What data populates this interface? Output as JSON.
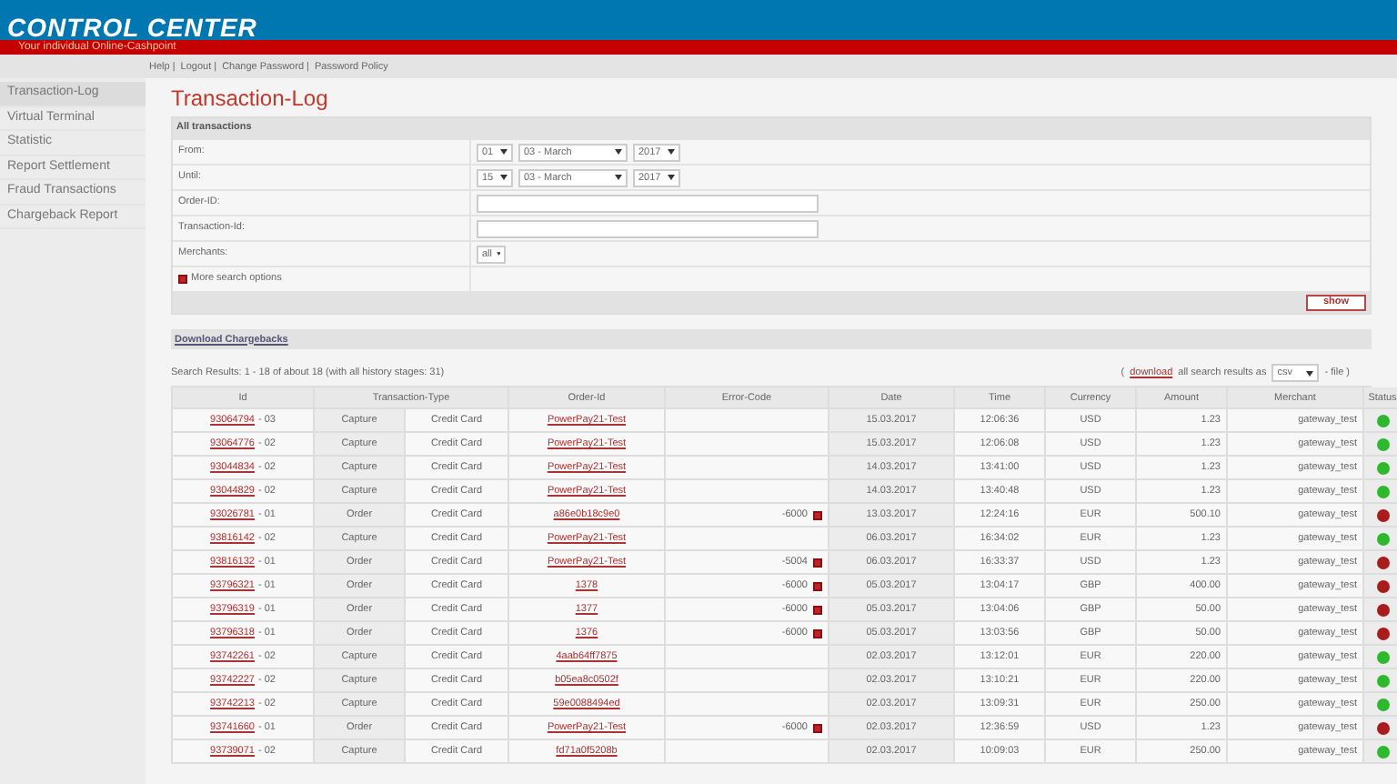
{
  "header": {
    "title": "CONTROL CENTER",
    "subtitle": "Your individual Online-Cashpoint"
  },
  "top_links": [
    "Help |",
    "Logout |",
    "Change Password |",
    "Password Policy"
  ],
  "sidebar": {
    "items": [
      {
        "label": "Transaction-Log",
        "selected": true
      },
      {
        "label": "Virtual Terminal",
        "selected": false
      },
      {
        "label": "Statistic",
        "selected": false
      },
      {
        "label": "Report Settlement",
        "selected": false
      },
      {
        "label": "Fraud Transactions",
        "selected": false
      },
      {
        "label": "Chargeback Report",
        "selected": false
      }
    ]
  },
  "page_title": "Transaction-Log",
  "search_panel": {
    "title": "All transactions",
    "fields": [
      {
        "kind": "date",
        "label": "From:",
        "day": "01",
        "month": "03 - March",
        "year": "2017"
      },
      {
        "kind": "date",
        "label": "Until:",
        "day": "15",
        "month": "03 - March",
        "year": "2017"
      },
      {
        "kind": "text",
        "label": "Order-ID:"
      },
      {
        "kind": "text",
        "label": "Transaction-Id:"
      },
      {
        "kind": "select",
        "label": "Merchants:",
        "value": "all"
      }
    ],
    "more_options": "More search options",
    "show_button": "show"
  },
  "download_chargebacks": "Download Chargebacks",
  "results": {
    "summary": "Search Results:  1 - 18 of about  18  (with all history stages: 31)",
    "export_open": "(",
    "export_link": "download",
    "export_text": "all search results as",
    "export_format": "csv",
    "export_close": "- file )"
  },
  "table": {
    "columns": [
      "Id",
      "Transaction-Type",
      "Order-Id",
      "Error-Code",
      "Date",
      "Time",
      "Currency",
      "Amount",
      "Merchant",
      "Status"
    ],
    "rows": [
      {
        "id": "93064794",
        "stage": "- 03",
        "type": "Capture",
        "method": "Credit Card",
        "order": "PowerPay21-Test",
        "error": "",
        "date": "15.03.2017",
        "time": "12:06:36",
        "currency": "USD",
        "amount": "1.23",
        "merchant": "gateway_test",
        "color": "#2db82d"
      },
      {
        "id": "93064776",
        "stage": "- 02",
        "type": "Capture",
        "method": "Credit Card",
        "order": "PowerPay21-Test",
        "error": "",
        "date": "15.03.2017",
        "time": "12:06:08",
        "currency": "USD",
        "amount": "1.23",
        "merchant": "gateway_test",
        "color": "#2db82d"
      },
      {
        "id": "93044834",
        "stage": "- 02",
        "type": "Capture",
        "method": "Credit Card",
        "order": "PowerPay21-Test",
        "error": "",
        "date": "14.03.2017",
        "time": "13:41:00",
        "currency": "USD",
        "amount": "1.23",
        "merchant": "gateway_test",
        "color": "#2db82d"
      },
      {
        "id": "93044829",
        "stage": "- 02",
        "type": "Capture",
        "method": "Credit Card",
        "order": "PowerPay21-Test",
        "error": "",
        "date": "14.03.2017",
        "time": "13:40:48",
        "currency": "USD",
        "amount": "1.23",
        "merchant": "gateway_test",
        "color": "#2db82d"
      },
      {
        "id": "93026781",
        "stage": "- 01",
        "type": "Order",
        "method": "Credit Card",
        "order": "a86e0b18c9e0",
        "error": "-6000",
        "date": "13.03.2017",
        "time": "12:24:16",
        "currency": "EUR",
        "amount": "500.10",
        "merchant": "gateway_test",
        "color": "#a81c1c"
      },
      {
        "id": "93816142",
        "stage": "- 02",
        "type": "Capture",
        "method": "Credit Card",
        "order": "PowerPay21-Test",
        "error": "",
        "date": "06.03.2017",
        "time": "16:34:02",
        "currency": "EUR",
        "amount": "1.23",
        "merchant": "gateway_test",
        "color": "#2db82d"
      },
      {
        "id": "93816132",
        "stage": "- 01",
        "type": "Order",
        "method": "Credit Card",
        "order": "PowerPay21-Test",
        "error": "-5004",
        "date": "06.03.2017",
        "time": "16:33:37",
        "currency": "USD",
        "amount": "1.23",
        "merchant": "gateway_test",
        "color": "#a81c1c"
      },
      {
        "id": "93796321",
        "stage": "- 01",
        "type": "Order",
        "method": "Credit Card",
        "order": "1378",
        "error": "-6000",
        "date": "05.03.2017",
        "time": "13:04:17",
        "currency": "GBP",
        "amount": "400.00",
        "merchant": "gateway_test",
        "color": "#a81c1c"
      },
      {
        "id": "93796319",
        "stage": "- 01",
        "type": "Order",
        "method": "Credit Card",
        "order": "1377",
        "error": "-6000",
        "date": "05.03.2017",
        "time": "13:04:06",
        "currency": "GBP",
        "amount": "50.00",
        "merchant": "gateway_test",
        "color": "#a81c1c"
      },
      {
        "id": "93796318",
        "stage": "- 01",
        "type": "Order",
        "method": "Credit Card",
        "order": "1376",
        "error": "-6000",
        "date": "05.03.2017",
        "time": "13:03:56",
        "currency": "GBP",
        "amount": "50.00",
        "merchant": "gateway_test",
        "color": "#a81c1c"
      },
      {
        "id": "93742261",
        "stage": "- 02",
        "type": "Capture",
        "method": "Credit Card",
        "order": "4aab64ff7875",
        "error": "",
        "date": "02.03.2017",
        "time": "13:12:01",
        "currency": "EUR",
        "amount": "220.00",
        "merchant": "gateway_test",
        "color": "#2db82d"
      },
      {
        "id": "93742227",
        "stage": "- 02",
        "type": "Capture",
        "method": "Credit Card",
        "order": "b05ea8c0502f",
        "error": "",
        "date": "02.03.2017",
        "time": "13:10:21",
        "currency": "EUR",
        "amount": "220.00",
        "merchant": "gateway_test",
        "color": "#2db82d"
      },
      {
        "id": "93742213",
        "stage": "- 02",
        "type": "Capture",
        "method": "Credit Card",
        "order": "59e0088494ed",
        "error": "",
        "date": "02.03.2017",
        "time": "13:09:31",
        "currency": "EUR",
        "amount": "250.00",
        "merchant": "gateway_test",
        "color": "#2db82d"
      },
      {
        "id": "93741660",
        "stage": "- 01",
        "type": "Order",
        "method": "Credit Card",
        "order": "PowerPay21-Test",
        "error": "-6000",
        "date": "02.03.2017",
        "time": "12:36:59",
        "currency": "USD",
        "amount": "1.23",
        "merchant": "gateway_test",
        "color": "#a81c1c"
      },
      {
        "id": "93739071",
        "stage": "- 02",
        "type": "Capture",
        "method": "Credit Card",
        "order": "fd71a0f5208b",
        "error": "",
        "date": "02.03.2017",
        "time": "10:09:03",
        "currency": "EUR",
        "amount": "250.00",
        "merchant": "gateway_test",
        "color": "#2db82d"
      }
    ]
  }
}
